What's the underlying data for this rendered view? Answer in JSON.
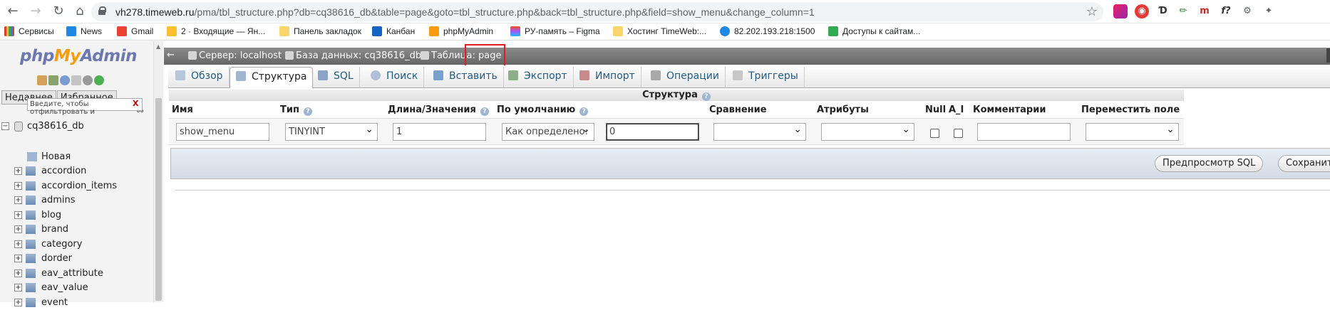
{
  "browser": {
    "url_host": "vh278.timeweb.ru",
    "url_path": "/pma/tbl_structure.php?db=cq38616_db&table=page&goto=tbl_structure.php&back=tbl_structure.php&field=show_menu&change_column=1",
    "bookmarks": [
      "Сервисы",
      "News",
      "Gmail",
      "2 · Входящие — Ян...",
      "Панель закладок",
      "Канбан",
      "phpMyAdmin",
      "РУ-память – Figma",
      "Хостинг TimeWeb:...",
      "82.202.193.218:1500",
      "Доступы к сайтам..."
    ],
    "ext_icons": [
      "cube-icon",
      "shield-icon",
      "d-icon",
      "pen-icon",
      "m-icon",
      "f-icon",
      "gear-icon",
      "puzzle-icon"
    ]
  },
  "sidebar": {
    "logo_php": "php",
    "logo_my": "My",
    "logo_admin": "Admin",
    "tabs": [
      "Недавнее",
      "Избранное"
    ],
    "filter_placeholder": "Введите, чтобы отфильтровать и",
    "filter_clear": "X",
    "database": "cq38616_db",
    "new_item": "Новая",
    "tables": [
      "accordion",
      "accordion_items",
      "admins",
      "blog",
      "brand",
      "category",
      "dorder",
      "eav_attribute",
      "eav_value",
      "event"
    ]
  },
  "breadcrumb": {
    "server": "Сервер: localhost »",
    "database": "База данных: cq38616_db »",
    "table": "Таблица: page"
  },
  "tabs": [
    "Обзор",
    "Структура",
    "SQL",
    "Поиск",
    "Вставить",
    "Экспорт",
    "Импорт",
    "Операции",
    "Триггеры"
  ],
  "active_tab": "Структура",
  "structure": {
    "title": "Структура",
    "headers": {
      "name": "Имя",
      "type": "Тип",
      "length": "Длина/Значения",
      "default": "По умолчанию",
      "collation": "Сравнение",
      "attributes": "Атрибуты",
      "null": "Null",
      "ai": "A_I",
      "comments": "Комментарии",
      "move": "Переместить поле"
    },
    "row": {
      "name": "show_menu",
      "type": "TINYINT",
      "length": "1",
      "default": "Как определено:",
      "default_value": "0",
      "collation": "",
      "attributes": "",
      "comments": "",
      "move": ""
    }
  },
  "buttons": {
    "preview_sql": "Предпросмотр SQL",
    "save": "Сохранить"
  },
  "colors": {
    "accent_blue": "#235a81",
    "highlight_red": "#e31b23"
  }
}
